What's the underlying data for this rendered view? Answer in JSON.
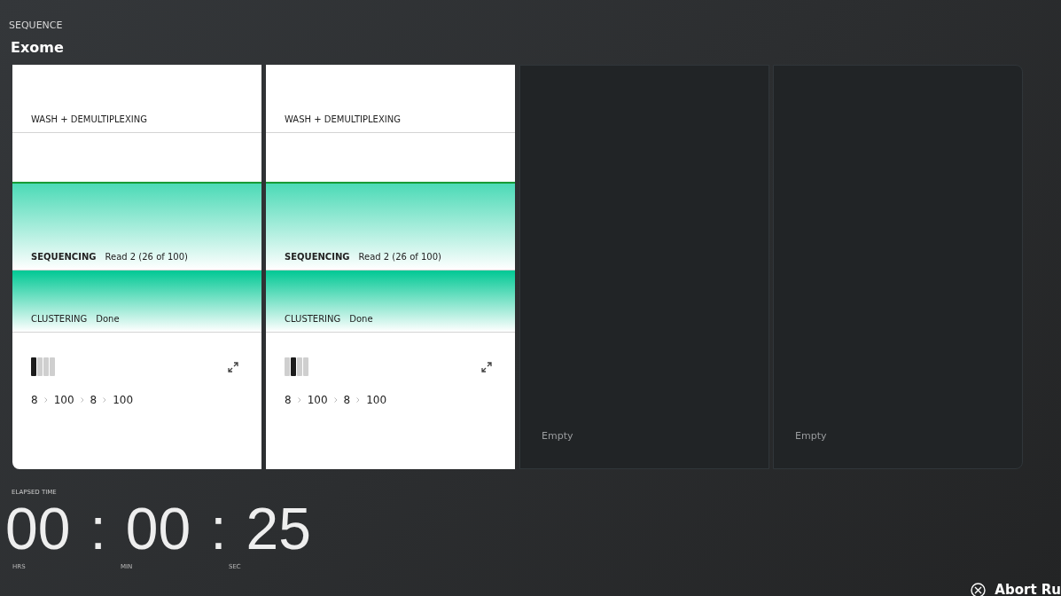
{
  "header": {
    "section": "SEQUENCE",
    "title": "Exome"
  },
  "lanes": [
    {
      "kind": "run",
      "stages": [
        {
          "name": "WASH + DEMULTIPLEXING",
          "kind": "pending"
        },
        {
          "name": "SEQUENCING",
          "detail": "Read 2 (26 of 100)",
          "kind": "active"
        },
        {
          "name": "CLUSTERING",
          "detail": "Done",
          "kind": "done"
        }
      ],
      "lane_bars": [
        {
          "selected": true
        },
        {
          "selected": false
        },
        {
          "selected": false
        },
        {
          "selected": false
        }
      ],
      "reads": [
        "8",
        "100",
        "8",
        "100"
      ]
    },
    {
      "kind": "run",
      "stages": [
        {
          "name": "WASH + DEMULTIPLEXING",
          "kind": "pending"
        },
        {
          "name": "SEQUENCING",
          "detail": "Read 2 (26 of 100)",
          "kind": "active"
        },
        {
          "name": "CLUSTERING",
          "detail": "Done",
          "kind": "done"
        }
      ],
      "lane_bars": [
        {
          "selected": false
        },
        {
          "selected": true
        },
        {
          "selected": false
        },
        {
          "selected": false
        }
      ],
      "reads": [
        "8",
        "100",
        "8",
        "100"
      ]
    },
    {
      "kind": "empty",
      "label": "Empty"
    },
    {
      "kind": "empty",
      "label": "Empty"
    }
  ],
  "timer": {
    "label": "ELAPSED TIME",
    "hours": "00",
    "minutes": "00",
    "seconds": "25",
    "separator": ":",
    "units": [
      "HRS",
      "MIN",
      "SEC"
    ]
  },
  "abort_button": {
    "label": "Abort Ru"
  }
}
